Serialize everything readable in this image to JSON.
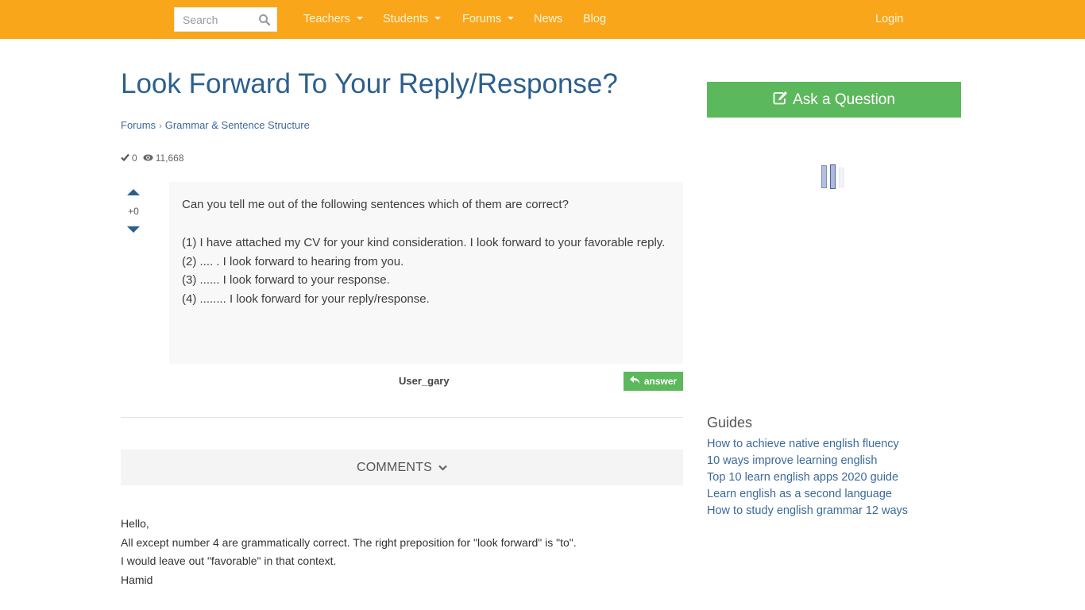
{
  "nav": {
    "search_placeholder": "Search",
    "items": [
      {
        "label": "Teachers",
        "has_dropdown": true
      },
      {
        "label": "Students",
        "has_dropdown": true
      },
      {
        "label": "Forums",
        "has_dropdown": true
      },
      {
        "label": "News",
        "has_dropdown": false
      },
      {
        "label": "Blog",
        "has_dropdown": false
      }
    ],
    "login_label": "Login",
    "bar_color": "#f9a61b"
  },
  "question": {
    "title": "Look Forward To Your Reply/Response?",
    "breadcrumb": [
      "Forums",
      "Grammar & Sentence Structure"
    ],
    "answers_count": "0",
    "views_count": "11,668",
    "vote_score": "+0",
    "body": {
      "intro": "Can you tell me out of the following sentences which of them are correct?",
      "lines": [
        "(1) I have attached my CV for your kind consideration. I look forward to your favorable reply.",
        "(2) .... . I look forward to hearing from you.",
        "(3) ...... I look forward to your response.",
        "(4) ........ I look forward for your reply/response."
      ]
    },
    "author": "User_gary",
    "answer_button": "answer"
  },
  "comments": {
    "toggle_label": "COMMENTS",
    "items": [
      {
        "lines": [
          "Hello,",
          "All except number 4 are grammatically correct. The right preposition for \"look forward\" is \"to\".",
          "I would leave out \"favorable\" in that context.",
          "Hamid"
        ]
      }
    ]
  },
  "sidebar": {
    "ask_button": "Ask a Question",
    "accent_green": "#5cb85c",
    "guides_title": "Guides",
    "guides": [
      "How to achieve native english fluency",
      "10 ways improve learning english",
      "Top 10 learn english apps 2020 guide",
      "Learn english as a second language",
      "How to study english grammar 12 ways"
    ]
  }
}
